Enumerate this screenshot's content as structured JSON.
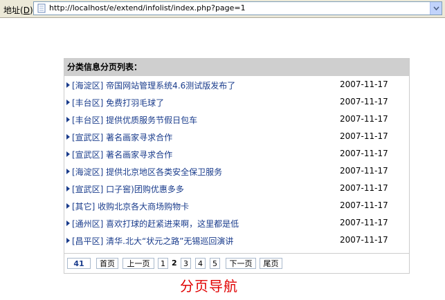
{
  "address_bar": {
    "label": "地址",
    "accel": "D",
    "url": "http://localhost/e/extend/infolist/index.php?page=1"
  },
  "list": {
    "heading": "分类信息分页列表：",
    "items": [
      {
        "title": "[海淀区] 帝国网站管理系统4.6测试版发布了",
        "date": "2007-11-17"
      },
      {
        "title": "[丰台区] 免费打羽毛球了",
        "date": "2007-11-17"
      },
      {
        "title": "[丰台区] 提供优质服务节假日包车",
        "date": "2007-11-17"
      },
      {
        "title": "[宣武区] 著名画家寻求合作",
        "date": "2007-11-17"
      },
      {
        "title": "[宣武区] 著名画家寻求合作",
        "date": "2007-11-17"
      },
      {
        "title": "[海淀区] 提供北京地区各类安全保卫服务",
        "date": "2007-11-17"
      },
      {
        "title": "[宣武区] 口子窖)团购优惠多多",
        "date": "2007-11-17"
      },
      {
        "title": "[其它] 收购北京各大商场购物卡",
        "date": "2007-11-17"
      },
      {
        "title": "[通州区] 喜欢打球的赶紧进来啊，这里都是低",
        "date": "2007-11-17"
      },
      {
        "title": "[昌平区] 清华.北大“状元之路”无锡巡回演讲",
        "date": "2007-11-17"
      }
    ]
  },
  "pager": {
    "total": "41",
    "first": "首页",
    "prev": "上一页",
    "pages": [
      "1",
      "2",
      "3",
      "4",
      "5"
    ],
    "current": "2",
    "next": "下一页",
    "last": "尾页"
  },
  "caption": "分页导航",
  "colors": {
    "link": "#1a3c8c",
    "header_bg": "#cfcfcf",
    "caption": "#e00000"
  }
}
